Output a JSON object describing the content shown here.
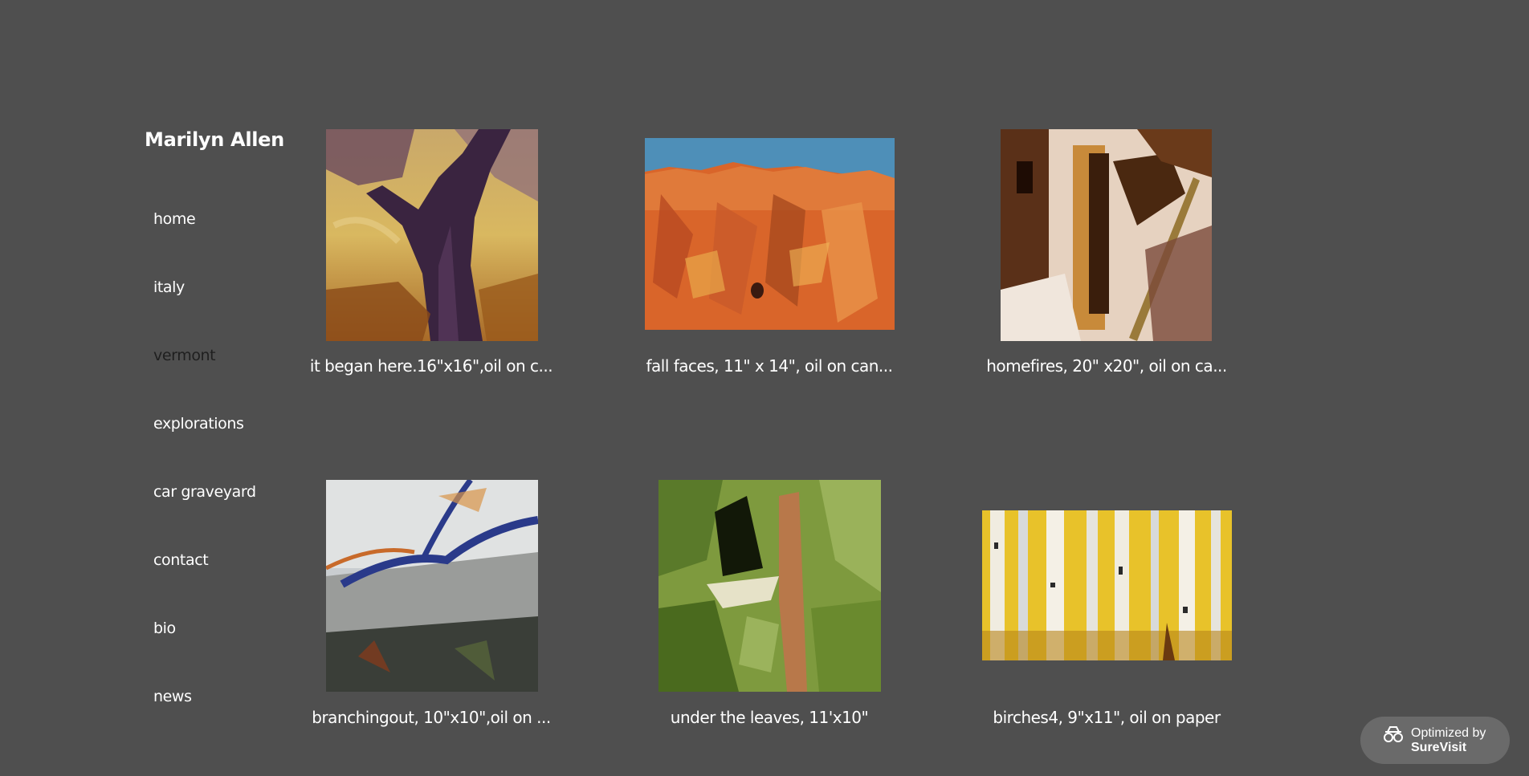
{
  "site": {
    "title": "Marilyn Allen"
  },
  "nav": {
    "items": [
      {
        "label": "home"
      },
      {
        "label": "italy"
      },
      {
        "label": "vermont"
      },
      {
        "label": "explorations"
      },
      {
        "label": "car graveyard"
      },
      {
        "label": "contact"
      },
      {
        "label": "bio"
      },
      {
        "label": "news"
      }
    ]
  },
  "gallery": {
    "items": [
      {
        "caption": "it began here.16\"x16\",oil on c..."
      },
      {
        "caption": "fall faces, 11\" x 14\", oil on can..."
      },
      {
        "caption": "homefires, 20\" x20\", oil on ca..."
      },
      {
        "caption": "branchingout, 10\"x10\",oil on ..."
      },
      {
        "caption": "under the leaves, 11'x10\""
      },
      {
        "caption": "birches4, 9\"x11\", oil on paper"
      }
    ]
  },
  "badge": {
    "line1": "Optimized by",
    "line2": "SureVisit"
  },
  "colors": {
    "background": "#4f4f4f",
    "text": "#ffffff",
    "active_nav": "#1f1f1f",
    "badge": "#6a6a6a"
  }
}
